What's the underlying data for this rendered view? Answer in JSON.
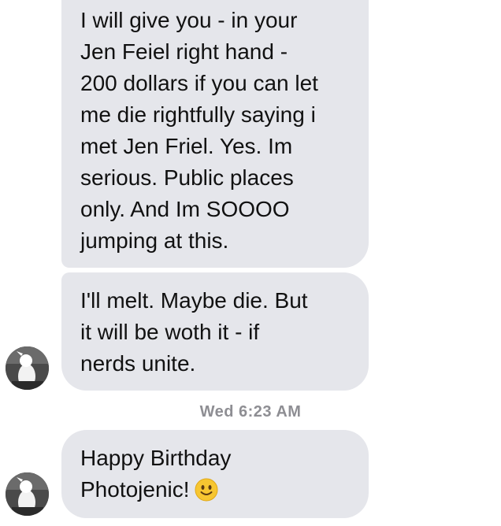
{
  "messages": [
    {
      "lines": [
        "I will give you - in your",
        "Jen Feiel right hand -",
        "200 dollars if you can let",
        "me die rightfully saying i",
        "met Jen Friel. Yes. Im",
        "serious. Public places",
        "only. And Im SOOOO",
        "jumping at this."
      ]
    },
    {
      "lines": [
        "I'll melt. Maybe die. But",
        "it will be woth it - if",
        "nerds unite."
      ]
    },
    {
      "lines": [
        "Happy Birthday",
        "Photojenic!"
      ],
      "emoji": "slightly-smiling-face"
    }
  ],
  "timestamp": "Wed 6:23 AM",
  "colors": {
    "bubble_background": "#e5e6eb",
    "message_text": "#111111",
    "timestamp_text": "#8e8e93"
  }
}
